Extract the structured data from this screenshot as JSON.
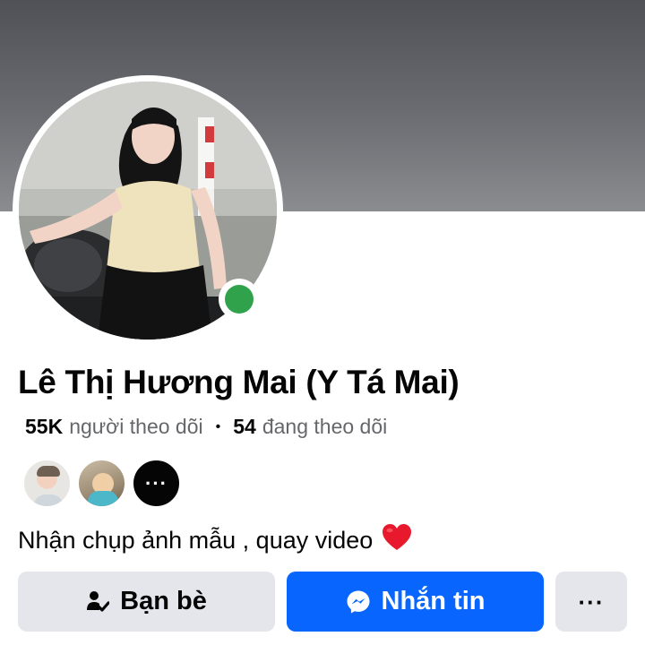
{
  "profile": {
    "name": "Lê Thị Hương Mai (Y Tá Mai)",
    "followers_count": "55K",
    "followers_label": "người theo dõi",
    "following_count": "54",
    "following_label": "đang theo dõi",
    "separator": "•",
    "bio": "Nhận chụp ảnh mẫu , quay video",
    "bio_emoji": "heart-emoji",
    "online": true
  },
  "mutual_friends": {
    "more_label": "···"
  },
  "actions": {
    "friends_label": "Bạn bè",
    "message_label": "Nhắn tin",
    "more_label": "···"
  },
  "colors": {
    "primary_blue": "#0866ff",
    "secondary_gray": "#e4e6eb",
    "online_green": "#31a24c",
    "text_primary": "#050505",
    "text_secondary": "#65676b",
    "heart_red": "#e8192c"
  },
  "icons": {
    "friends_button": "friend-check-icon",
    "message_button": "messenger-icon",
    "more_button": "more-dots-icon"
  }
}
